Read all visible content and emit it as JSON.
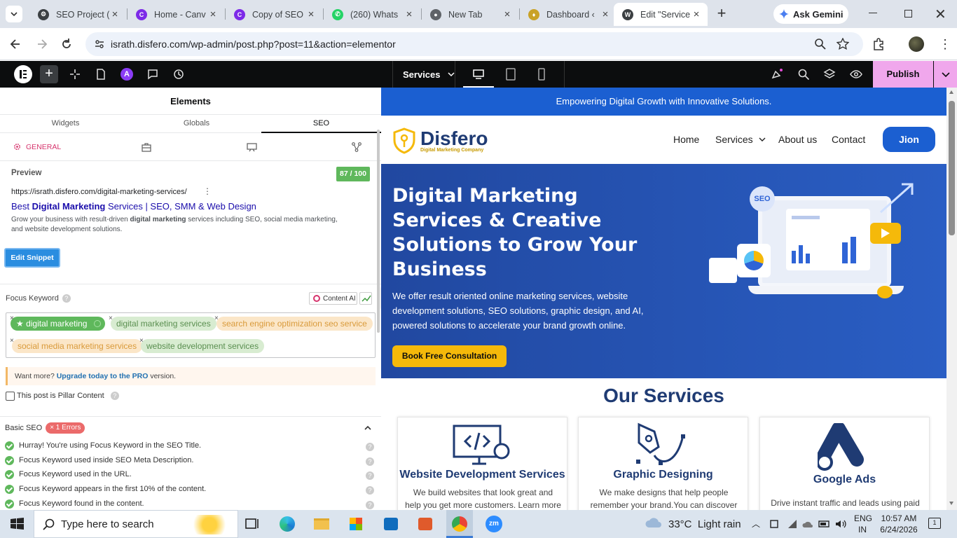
{
  "browser": {
    "tabs": [
      {
        "title": "SEO Project (",
        "color": "#3c4043",
        "icon": "gear-tab-icon"
      },
      {
        "title": "Home - Canv",
        "color": "#7d2ae8",
        "icon": "canva-icon"
      },
      {
        "title": "Copy of SEO",
        "color": "#7d2ae8",
        "icon": "canva-icon"
      },
      {
        "title": "(260) Whats",
        "color": "#25d366",
        "icon": "whatsapp-icon"
      },
      {
        "title": "New Tab",
        "color": "#5f6368",
        "icon": "chrome-icon"
      },
      {
        "title": "Dashboard ‹",
        "color": "#c9a227",
        "icon": "shield-icon"
      },
      {
        "title": "Edit \"Service",
        "color": "#3c4043",
        "icon": "wordpress-icon"
      }
    ],
    "gemini_label": "Ask Gemini",
    "url": "israth.disfero.com/wp-admin/post.php?post=11&action=elementor"
  },
  "editor": {
    "page_selector": "Services",
    "publish_label": "Publish"
  },
  "panel": {
    "title": "Elements",
    "tabs": [
      "Widgets",
      "Globals",
      "SEO"
    ],
    "general_label": "GENERAL",
    "preview_label": "Preview",
    "score": "87 / 100",
    "snippet_url": "https://israth.disfero.com/digital-marketing-services/",
    "snippet_title_a": "Best ",
    "snippet_title_b": "Digital Marketing",
    "snippet_title_c": " Services | SEO, SMM & Web Design",
    "snippet_desc_a": "Grow your business with result-driven ",
    "snippet_desc_b": "digital marketing",
    "snippet_desc_c": " services including SEO, social media marketing, and website development solutions.",
    "edit_snippet": "Edit Snippet",
    "focus_keyword_label": "Focus Keyword",
    "content_ai_label": "Content AI",
    "keywords": [
      "digital marketing",
      "digital marketing services",
      "search engine optimization seo service",
      "social media marketing services",
      "website development services"
    ],
    "upgrade_pre": "Want more? ",
    "upgrade_link": "Upgrade today to the PRO",
    "upgrade_post": " version.",
    "pillar_label": "This post is Pillar Content",
    "basic_seo_label": "Basic SEO",
    "errors_badge": "× 1 Errors",
    "checks": [
      "Hurray! You're using Focus Keyword in the SEO Title.",
      "Focus Keyword used inside SEO Meta Description.",
      "Focus Keyword used in the URL.",
      "Focus Keyword appears in the first 10% of the content.",
      "Focus Keyword found in the content."
    ]
  },
  "site": {
    "topbar_text": "Empowering Digital Growth with Innovative Solutions.",
    "logo_name": "Disfero",
    "logo_tagline": "Digital Marketing Company",
    "nav": [
      "Home",
      "Services",
      "About us",
      "Contact"
    ],
    "join_label": "Jion",
    "hero_title": "Digital Marketing Services & Creative Solutions to Grow Your Business",
    "hero_text": "We offer result oriented online marketing services, website development solutions, SEO solutions, graphic design, and AI, powered solutions to accelerate your brand growth online.",
    "hero_button": "Book Free Consultation",
    "hero_art_label": "SEO",
    "services_title": "Our Services",
    "services": [
      {
        "title": "Website Development Services",
        "text": "We build websites that look great and help you get more customers. Learn more about"
      },
      {
        "title": "Graphic Designing",
        "text": "We make designs that help people remember your brand.You can discover more, about"
      },
      {
        "title": "Google Ads",
        "text": "Drive instant traffic and leads using paid"
      }
    ]
  },
  "taskbar": {
    "search_placeholder": "Type here to search",
    "weather": "33°C  Light rain",
    "lang_1": "ENG",
    "lang_2": "IN",
    "time": "10:57 AM",
    "date": "6/24/2026",
    "notif_count": "1"
  },
  "colors": {
    "accent": "#1b5fd1",
    "brand_blue": "#1f4fa8",
    "pink": "#f0a7ec",
    "gold": "#f5b90a",
    "navy": "#1f3b73"
  }
}
